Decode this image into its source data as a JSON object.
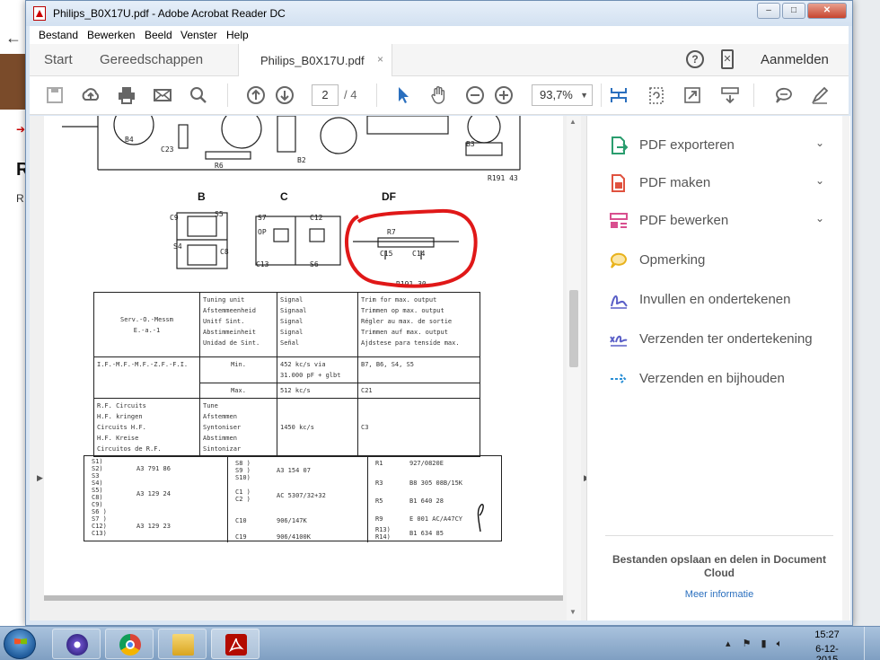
{
  "window": {
    "title": "Philips_B0X17U.pdf - Adobe Acrobat Reader DC",
    "minimize": "–",
    "maximize": "□",
    "close": "✕"
  },
  "menu": [
    "Bestand",
    "Bewerken",
    "Beeld",
    "Venster",
    "Help"
  ],
  "tabs": {
    "start": "Start",
    "tools": "Gereedschappen",
    "document": "Philips_B0X17U.pdf",
    "document_close": "×",
    "signin": "Aanmelden"
  },
  "toolbar": {
    "page_current": "2",
    "page_total": "/ 4",
    "zoom": "93,7%",
    "icons": [
      "save-icon",
      "upload-icon",
      "print-icon",
      "email-icon",
      "search-icon",
      "page-up-icon",
      "page-down-icon",
      "select-cursor-icon",
      "hand-icon",
      "zoom-out-icon",
      "zoom-in-icon",
      "fit-page-icon",
      "rotate-icon",
      "fullscreen-icon",
      "scroll-mode-icon",
      "comment-icon",
      "sign-icon"
    ]
  },
  "document": {
    "sections": [
      "B",
      "C",
      "DF"
    ],
    "schematic_labels": [
      "B4",
      "B2",
      "B3",
      "R6",
      "C23",
      "R191 43",
      "R7",
      "C15",
      "C14",
      "C9",
      "C8",
      "S4",
      "S5",
      "S7",
      "S6",
      "C12",
      "C13",
      "OP",
      "R191 30"
    ],
    "table1": {
      "header_left": "Serv.-O.-Messm\nE.-a.-1",
      "header_mid": "Tuning unit\nAfstemmeenheid\nUnitf Sint.\nAbstimmeinheit\nUnidad de Sint.",
      "header_sig": "Signal\nSignaal\nSignal\nSignal\nSeñal",
      "header_right": "Trim for max. output\nTrimmen op max. output\nRégler au max. de sortie\nTrimmen auf max. output\nAjdstese para tensíde max.",
      "row1_left": "I.F.-M.F.-M.F.-Z.F.-F.I.",
      "row1_mid": "Min.",
      "row1_sig": "452 kc/s via\n31.000 pF + glbt",
      "row1_right": "B7, B6, S4, S5",
      "row2_mid": "Max.",
      "row2_sig": "512 kc/s",
      "row2_right": "C21",
      "row3_left": "R.F. Circuits\nH.F. kringen\nCircuits H.F.\nH.F. Kreise\nCircuitos de R.F.",
      "row3_mid": "Tune\nAfstemmen\nSyntoniser\nAbstimmen\nSintonizar",
      "row3_sig": "1450 kc/s",
      "row3_right": "C3"
    },
    "table2": {
      "col1_codes": [
        "S1)",
        "S2)",
        "S3",
        "S4)",
        "S5)",
        "C8)",
        "C9)",
        "S6 )",
        "S7 )",
        "C12)",
        "C13)"
      ],
      "col1_parts": [
        "A3 791 86",
        "A3 129 24",
        "A3 129 23"
      ],
      "col2_codes": [
        "S8 )",
        "S9 )",
        "S10)",
        "C1 )",
        "C2 )",
        "C10",
        "C19"
      ],
      "col2_parts": [
        "A3 154 07",
        "AC 5307/32+32",
        "906/147K",
        "906/4100K"
      ],
      "col3_codes": [
        "R1",
        "R3",
        "R5",
        "R9",
        "R13)",
        "R14)"
      ],
      "col3_parts": [
        "927/0820E",
        "B8 305 08B/15K",
        "B1 640 28",
        "E 001 AC/A47CY",
        "B1 634 85"
      ]
    }
  },
  "tools_panel": {
    "items": [
      {
        "label": "PDF exporteren",
        "icon": "export-pdf-icon",
        "color": "#2a9d6e",
        "expandable": true
      },
      {
        "label": "PDF maken",
        "icon": "create-pdf-icon",
        "color": "#e0523f",
        "expandable": true
      },
      {
        "label": "PDF bewerken",
        "icon": "edit-pdf-icon",
        "color": "#d94f8f",
        "expandable": true
      },
      {
        "label": "Opmerking",
        "icon": "comment-icon",
        "color": "#e8b21c",
        "expandable": false
      },
      {
        "label": "Invullen en ondertekenen",
        "icon": "fill-sign-icon",
        "color": "#5a5fc7",
        "expandable": false
      },
      {
        "label": "Verzenden ter ondertekening",
        "icon": "send-sign-icon",
        "color": "#5a5fc7",
        "expandable": false
      },
      {
        "label": "Verzenden en bijhouden",
        "icon": "send-track-icon",
        "color": "#2a8fd6",
        "expandable": false
      }
    ],
    "cloud_text": "Bestanden opslaan en delen in Document Cloud",
    "more_link": "Meer informatie"
  },
  "taskbar": {
    "apps": [
      "start-orb",
      "app-icon",
      "chrome-icon",
      "explorer-icon",
      "acrobat-icon"
    ],
    "clock_time": "15:27",
    "clock_date": "6-12-2015"
  }
}
